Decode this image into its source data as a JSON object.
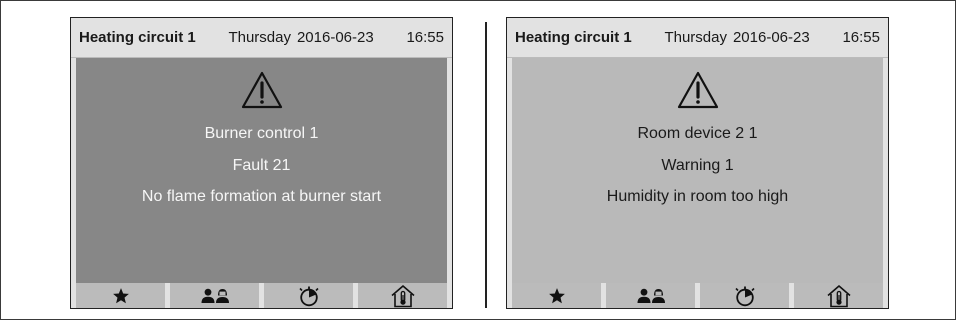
{
  "panels": [
    {
      "header": {
        "title": "Heating circuit 1",
        "day": "Thursday",
        "date": "2016-06-23",
        "time": "16:55"
      },
      "message": {
        "icon": "warning-triangle-icon",
        "source": "Burner control 1",
        "code": "Fault 21",
        "description": "No flame formation at burner start",
        "background": "#878787"
      },
      "softkeys": [
        "favorites-star-icon",
        "users-icon",
        "timer-icon",
        "house-thermometer-icon"
      ]
    },
    {
      "header": {
        "title": "Heating circuit 1",
        "day": "Thursday",
        "date": "2016-06-23",
        "time": "16:55"
      },
      "message": {
        "icon": "warning-triangle-icon",
        "source": "Room device 2 1",
        "code": "Warning 1",
        "description": "Humidity in room too high",
        "background": "#b9b9b9"
      },
      "softkeys": [
        "favorites-star-icon",
        "users-icon",
        "timer-icon",
        "house-thermometer-icon"
      ]
    }
  ]
}
